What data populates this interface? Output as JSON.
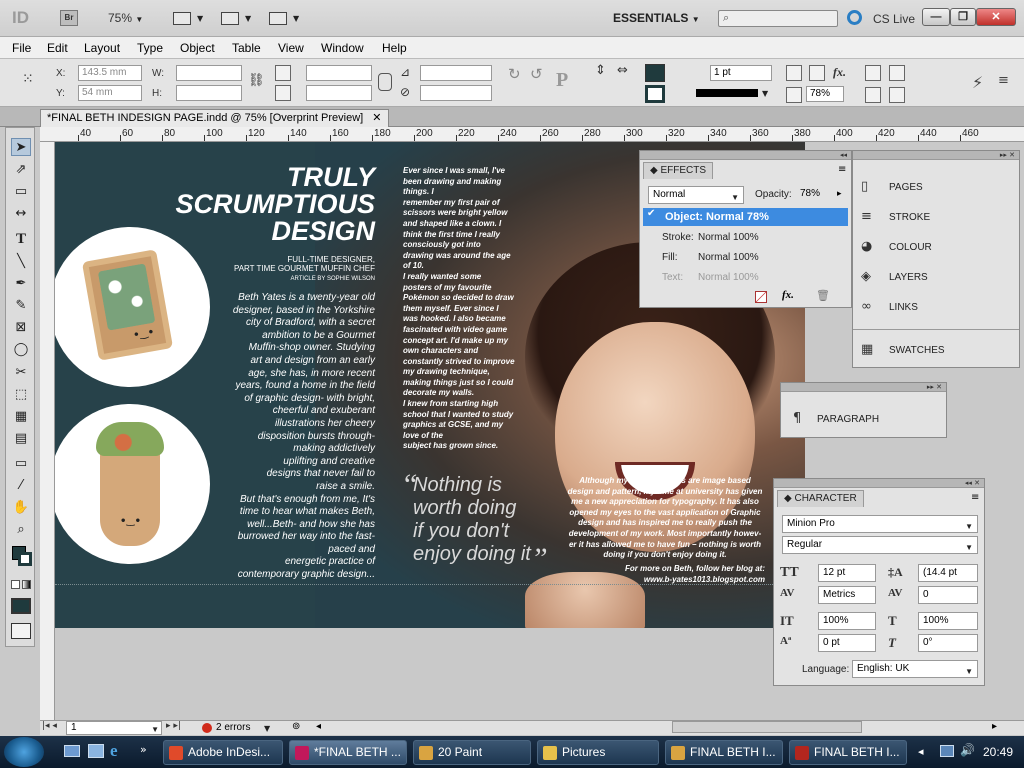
{
  "app": {
    "logo": "ID",
    "bridge": "Br",
    "zoom": "75%",
    "workspace": "ESSENTIALS",
    "cs_live": "CS Live",
    "window_buttons": [
      "—",
      "❐",
      "✕"
    ]
  },
  "menu": [
    "File",
    "Edit",
    "Layout",
    "Type",
    "Object",
    "Table",
    "View",
    "Window",
    "Help"
  ],
  "control": {
    "x_label": "X:",
    "x_value": "143.5 mm",
    "y_label": "Y:",
    "y_value": "54 mm",
    "w_label": "W:",
    "h_label": "H:",
    "stroke_weight": "1 pt",
    "opacity": "78%"
  },
  "document": {
    "tab_title": "*FINAL BETH INDESIGN PAGE.indd @ 75% [Overprint Preview]",
    "close": "✕",
    "ruler_ticks": [
      "40",
      "60",
      "80",
      "100",
      "120",
      "140",
      "160",
      "180",
      "200",
      "220",
      "240",
      "260",
      "280",
      "300",
      "320",
      "340",
      "360",
      "380",
      "400",
      "420",
      "440",
      "460"
    ]
  },
  "artwork": {
    "headline": [
      "TRULY",
      "SCRUMPTIOUS",
      "DESIGN"
    ],
    "subhead": [
      "FULL-TIME DESIGNER,",
      "PART TIME GOURMET MUFFIN CHEF"
    ],
    "byline": "ARTICLE BY SOPHIE WILSON",
    "body_left": [
      "Beth Yates is a twenty-year old",
      "designer, based in the Yorkshire",
      "city of Bradford, with a secret",
      "ambition to be a Gourmet",
      "Muffin-shop owner. Studying",
      "art and design from an early",
      "age, she has, in more recent",
      "years, found a home in the field",
      "of graphic design- with bright,",
      "cheerful and exuberant",
      "illustrations her cheery",
      "disposition bursts through-",
      "making addictively",
      "uplifting and creative",
      "designs that never fail to",
      "raise a smile.",
      "But that's enough from me, It's",
      "time to hear what makes Beth,",
      "well...Beth- and how she has",
      "burrowed her way into the fast-",
      "paced and",
      "energetic practice of",
      "contemporary graphic design..."
    ],
    "body_mid": [
      "Ever since I was small, I've",
      "been drawing and making",
      "things. I",
      "remember my first pair of",
      "scissors were bright yellow",
      "and shaped like a clown. I",
      "think the first time I really",
      "consciously got into",
      "drawing was around the age",
      "of 10.",
      "I really wanted some",
      "posters of my favourite",
      "Pokémon so decided to draw",
      "them myself. Ever since I",
      "was hooked. I also became",
      "fascinated with video game",
      "concept art. I'd make up my",
      "own characters and",
      "constantly strived to improve",
      "my drawing technique,",
      "making things just so I could",
      "decorate my walls.",
      "I knew from starting high",
      "school that I wanted to study",
      "graphics at GCSE, and my",
      "love of the",
      "subject has grown since."
    ],
    "quote_open": "“",
    "quote": [
      "Nothing is",
      "worth doing",
      "if you don't",
      "enjoy doing it"
    ],
    "quote_close": "”",
    "body_right": [
      "Although my main passions are image based",
      "design and pattern, my time at university has given",
      "me a new appreciation for typography. It has also",
      "opened my eyes to the vast application of Graphic",
      "design and has inspired me to really push the",
      "development of my work. Most importantly howev-",
      "er it has allowed me to have fun – nothing is worth",
      "doing if you don't enjoy doing it."
    ],
    "more_info": [
      "For more on Beth, follow her blog at:",
      "www.b-yates1013.blogspot.com"
    ]
  },
  "effects_panel": {
    "title": "EFFECTS",
    "blend_mode": "Normal",
    "opacity_label": "Opacity:",
    "opacity_value": "78%",
    "rows": [
      {
        "label": "Object:",
        "value": "Normal 78%"
      },
      {
        "label": "Stroke:",
        "value": "Normal 100%"
      },
      {
        "label": "Fill:",
        "value": "Normal 100%"
      },
      {
        "label": "Text:",
        "value": "Normal 100%"
      }
    ],
    "fx": "fx."
  },
  "side_panels": [
    "PAGES",
    "STROKE",
    "COLOUR",
    "LAYERS",
    "LINKS",
    "SWATCHES"
  ],
  "paragraph_panel": {
    "title": "PARAGRAPH"
  },
  "character_panel": {
    "title": "CHARACTER",
    "font_family": "Minion Pro",
    "font_style": "Regular",
    "font_size": "12 pt",
    "leading": "(14.4 pt",
    "kerning": "Metrics",
    "tracking": "0",
    "vertical_scale": "100%",
    "horizontal_scale": "100%",
    "baseline_shift": "0 pt",
    "skew": "0°",
    "language_label": "Language:",
    "language": "English: UK"
  },
  "status": {
    "page": "1",
    "errors": "2 errors"
  },
  "taskbar": {
    "items": [
      {
        "label": "Adobe InDesi...",
        "color": "#e04a2a"
      },
      {
        "label": "*FINAL BETH ...",
        "color": "#c2185b"
      },
      {
        "label": "20 Paint",
        "color": "#d9a441"
      },
      {
        "label": "Pictures",
        "color": "#e6c14b"
      },
      {
        "label": "FINAL BETH I...",
        "color": "#d9a441"
      },
      {
        "label": "FINAL BETH I...",
        "color": "#b3261e"
      }
    ],
    "time": "20:49"
  }
}
